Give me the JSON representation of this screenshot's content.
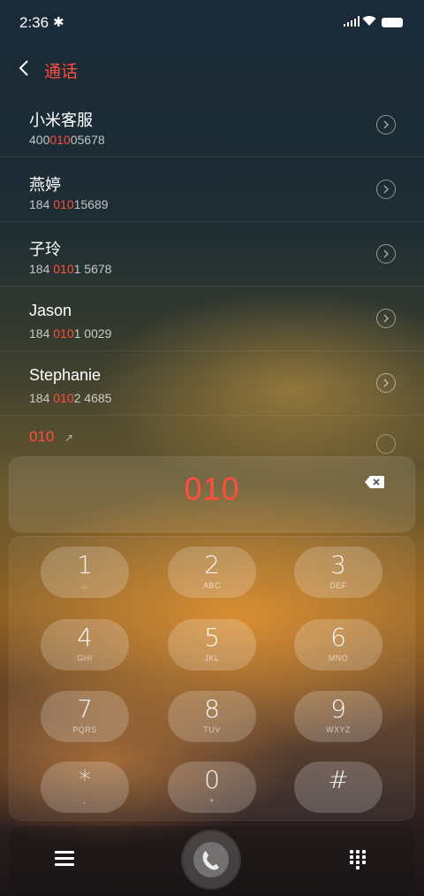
{
  "status": {
    "time": "2:36"
  },
  "header": {
    "title": "通话"
  },
  "contacts": [
    {
      "name": "小米客服",
      "num_pre": "400",
      "num_hl": "010",
      "num_post": "05678"
    },
    {
      "name": "燕婷",
      "num_pre": "184 ",
      "num_hl": "010",
      "num_post": "15689"
    },
    {
      "name": "子玲",
      "num_pre": "184 ",
      "num_hl": "010",
      "num_post": "1 5678"
    },
    {
      "name": "Jason",
      "num_pre": "184 ",
      "num_hl": "010",
      "num_post": "1 0029"
    },
    {
      "name": "Stephanie",
      "num_pre": "184 ",
      "num_hl": "010",
      "num_post": "2 4685"
    }
  ],
  "new_number": "010",
  "dialed": "010",
  "keys": [
    {
      "digit": "1",
      "letters": "⌕"
    },
    {
      "digit": "2",
      "letters": "ABC"
    },
    {
      "digit": "3",
      "letters": "DEF"
    },
    {
      "digit": "4",
      "letters": "GHI"
    },
    {
      "digit": "5",
      "letters": "JKL"
    },
    {
      "digit": "6",
      "letters": "MNO"
    },
    {
      "digit": "7",
      "letters": "PQRS"
    },
    {
      "digit": "8",
      "letters": "TUV"
    },
    {
      "digit": "9",
      "letters": "WXYZ"
    },
    {
      "digit": "*",
      "letters": ","
    },
    {
      "digit": "0",
      "letters": "+"
    },
    {
      "digit": "#",
      "letters": ""
    }
  ],
  "icons": {
    "bluetooth": "bluetooth-icon",
    "signal": "signal-icon",
    "wifi": "wifi-icon",
    "battery": "battery-icon",
    "back": "chevron-left-icon",
    "detail": "chevron-right-circle-icon",
    "backspace": "backspace-icon",
    "menu": "menu-icon",
    "call": "call-icon",
    "dialpad": "dialpad-icon"
  },
  "colors": {
    "accent": "#ff4d3f"
  }
}
